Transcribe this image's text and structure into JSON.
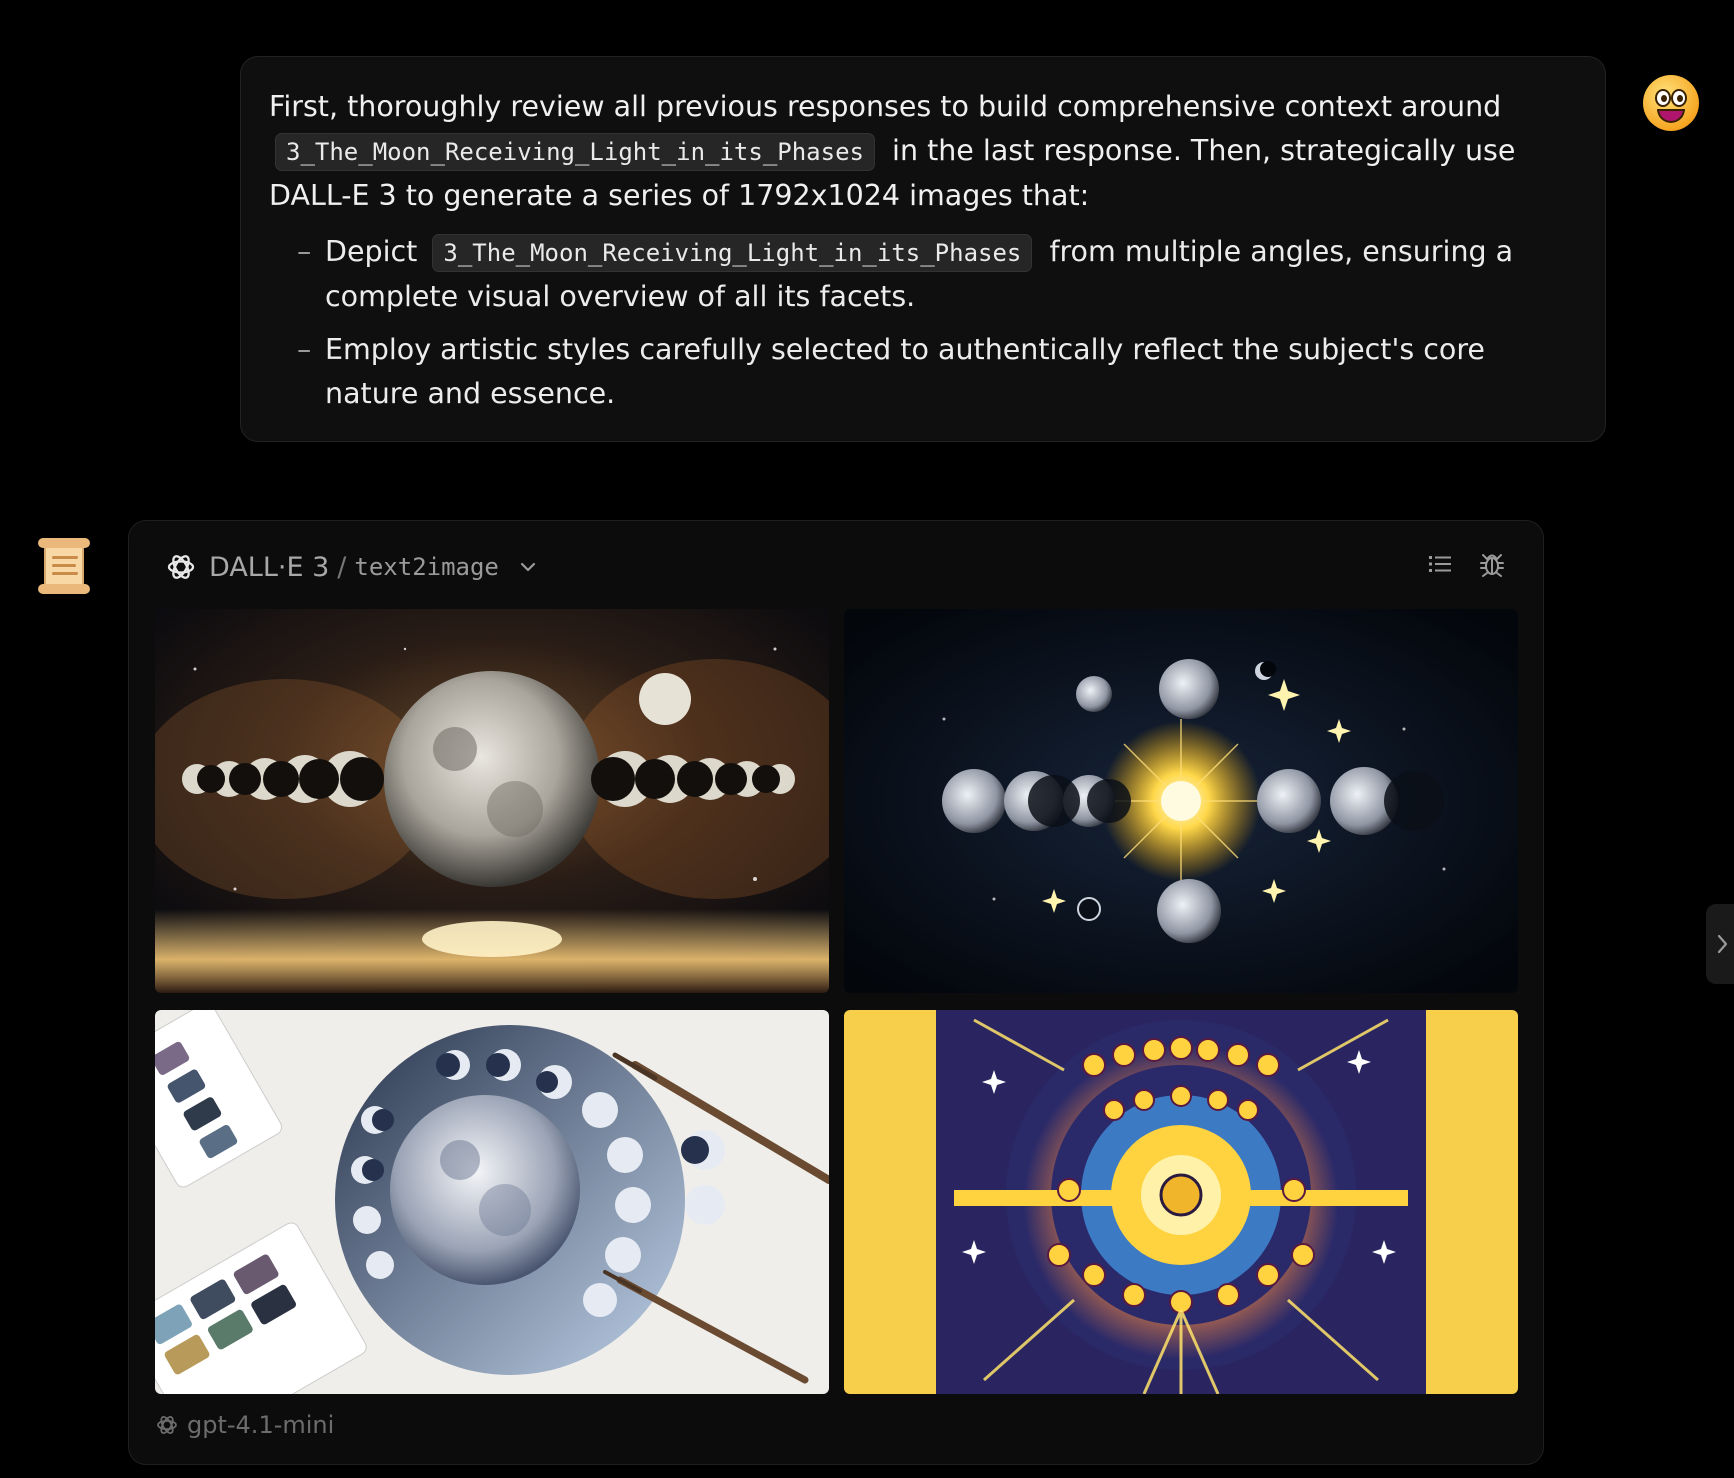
{
  "user_message": {
    "line1": "First, thoroughly review all previous responses to build comprehensive context around",
    "chip": "3_The_Moon_Receiving_Light_in_its_Phases",
    "line2_after": "in the last response. Then, strategically use",
    "line3": "DALL-E 3 to generate a series of 1792x1024 images that:",
    "bullet1_before": "Depict",
    "bullet1_chip": "3_The_Moon_Receiving_Light_in_its_Phases",
    "bullet1_after": "from multiple angles, ensuring a complete visual overview of all its facets.",
    "bullet2": "Employ artistic styles carefully selected to authentically reflect the subject's core nature and essence.",
    "bullet_dash": "–"
  },
  "tool": {
    "title": "DALL·E 3",
    "separator": "/",
    "subtitle": "text2image"
  },
  "footer": {
    "model": "gpt-4.1-mini"
  }
}
